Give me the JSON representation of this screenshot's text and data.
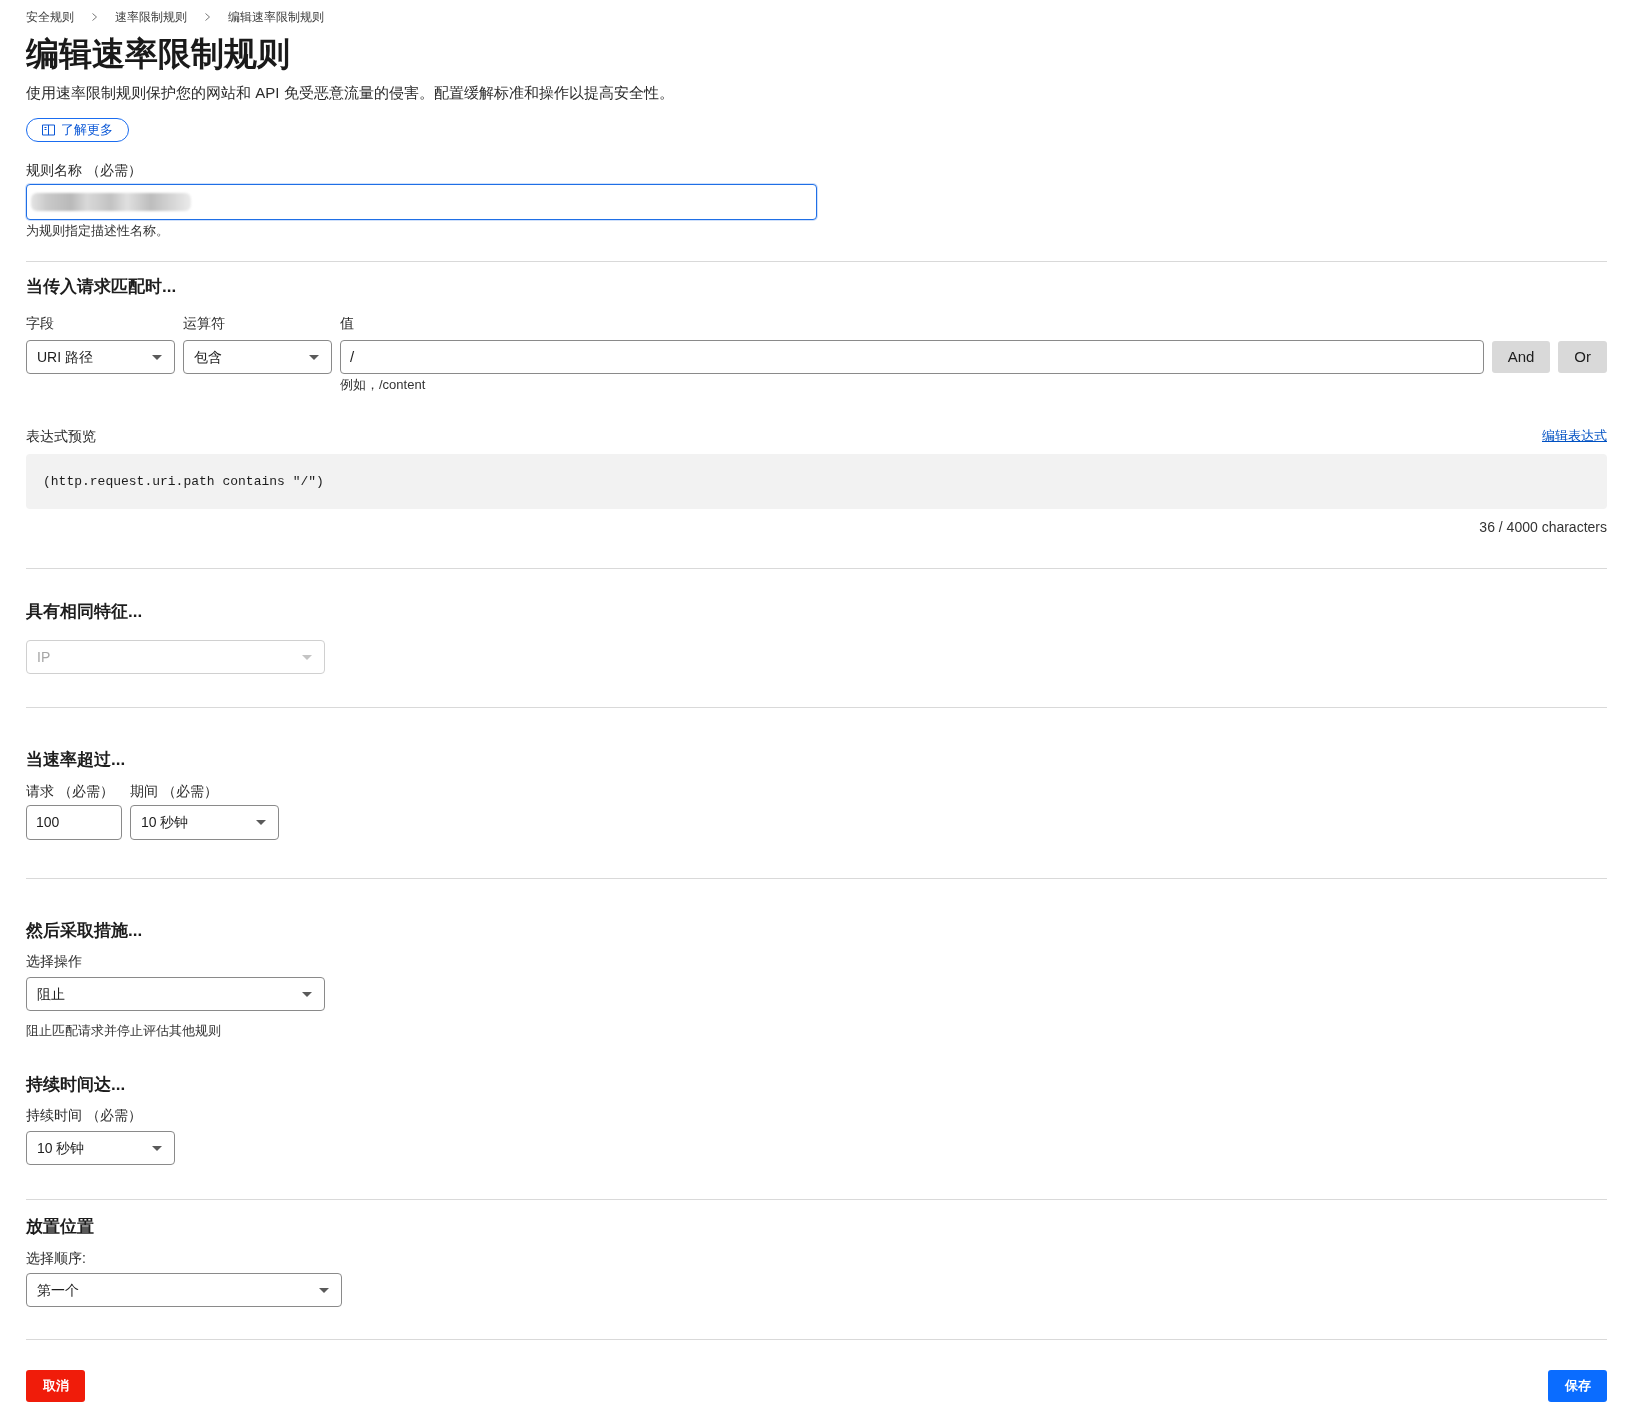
{
  "breadcrumb": [
    {
      "label": "安全规则"
    },
    {
      "label": "速率限制规则"
    },
    {
      "label": "编辑速率限制规则"
    }
  ],
  "page": {
    "title": "编辑速率限制规则",
    "description": "使用速率限制规则保护您的网站和 API 免受恶意流量的侵害。配置缓解标准和操作以提高安全性。",
    "learn_more": "了解更多"
  },
  "rule_name": {
    "label": "规则名称 （必需）",
    "focused": true,
    "value_blurred": true,
    "hint": "为规则指定描述性名称。"
  },
  "match": {
    "heading": "当传入请求匹配时...",
    "field": {
      "label": "字段",
      "value": "URI 路径"
    },
    "operator": {
      "label": "运算符",
      "value": "包含"
    },
    "value": {
      "label": "值",
      "value": "/",
      "hint": "例如，/content"
    },
    "buttons": [
      "And",
      "Or"
    ],
    "preview": {
      "label": "表达式预览",
      "edit_link": "编辑表达式",
      "expression": "(http.request.uri.path contains \"/\")",
      "count": "36 / 4000 characters"
    }
  },
  "characteristics": {
    "heading": "具有相同特征...",
    "select": {
      "value": "IP",
      "disabled": true
    }
  },
  "rate": {
    "heading": "当速率超过...",
    "requests": {
      "label": "请求 （必需）",
      "value": "100"
    },
    "period": {
      "label": "期间 （必需）",
      "value": "10 秒钟"
    }
  },
  "action": {
    "heading": "然后采取措施...",
    "label": "选择操作",
    "value": "阻止",
    "hint": "阻止匹配请求并停止评估其他规则"
  },
  "duration": {
    "heading": "持续时间达...",
    "label": "持续时间 （必需）",
    "value": "10 秒钟"
  },
  "placement": {
    "heading": "放置位置",
    "label": "选择顺序:",
    "value": "第一个"
  },
  "footer": {
    "cancel": "取消",
    "save": "保存"
  }
}
